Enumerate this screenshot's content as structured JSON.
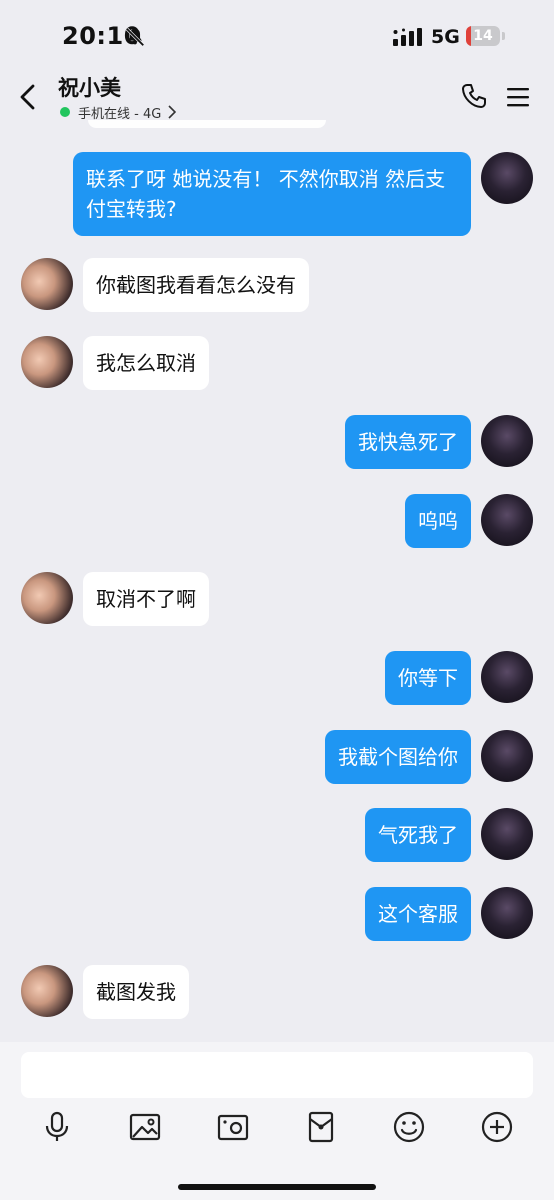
{
  "status_bar": {
    "time": "20:10",
    "network": "5G",
    "battery": "14",
    "battery_level": 0.14
  },
  "header": {
    "contact_name": "祝小美",
    "status": "手机在线 - 4G"
  },
  "messages": [
    {
      "sender": "self",
      "text": "联系了呀 她说没有！ 不然你取消 然后支付宝转我?"
    },
    {
      "sender": "other",
      "text": "你截图我看看怎么没有"
    },
    {
      "sender": "other",
      "text": "我怎么取消"
    },
    {
      "sender": "self",
      "text": "我快急死了"
    },
    {
      "sender": "self",
      "text": "呜呜"
    },
    {
      "sender": "other",
      "text": "取消不了啊"
    },
    {
      "sender": "self",
      "text": "你等下"
    },
    {
      "sender": "self",
      "text": "我截个图给你"
    },
    {
      "sender": "self",
      "text": "气死我了"
    },
    {
      "sender": "self",
      "text": "这个客服"
    },
    {
      "sender": "other",
      "text": "截图发我"
    }
  ],
  "input": {
    "value": "",
    "placeholder": ""
  },
  "toolbar_icons": [
    "microphone-icon",
    "image-icon",
    "camera-icon",
    "red-packet-icon",
    "emoji-icon",
    "plus-icon"
  ],
  "colors": {
    "self_bubble": "#1f96f3",
    "other_bubble": "#ffffff",
    "background": "#ededf2",
    "online": "#22c55e",
    "battery_low": "#e0413a"
  }
}
